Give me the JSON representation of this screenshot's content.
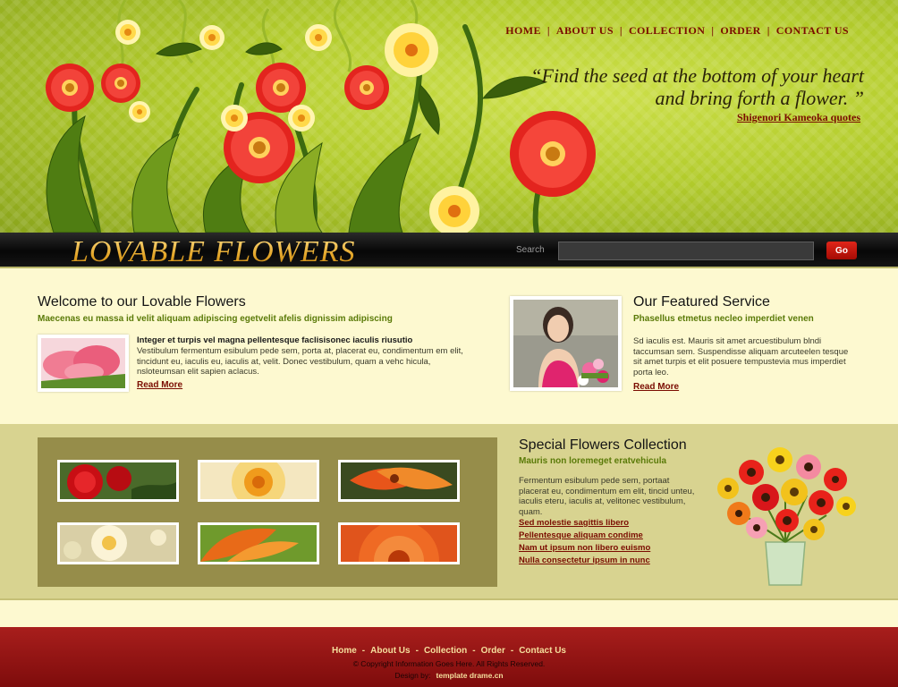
{
  "nav": {
    "home": "HOME",
    "about": "ABOUT US",
    "collection": "COLLECTION",
    "order": "ORDER",
    "contact": "CONTACT US",
    "separator": "|"
  },
  "quote": {
    "text": "“Find the seed at the bottom of your heart and bring forth a flower. ”",
    "author": "Shigenori Kameoka quotes"
  },
  "brand": {
    "logo": "LOVABLE FLOWERS"
  },
  "search": {
    "label": "Search",
    "value": "",
    "button": "Go"
  },
  "welcome": {
    "title": "Welcome to our Lovable Flowers",
    "subtitle": "Maecenas eu massa id velit aliquam adipiscing egetvelit afelis dignissim adipiscing",
    "heading": "Integer et turpis vel magna pellentesque faclisisonec iaculis riusutio",
    "body": "Vestibulum fermentum esibulum pede sem, porta at, placerat eu, condimentum em elit, tincidunt eu, iaculis eu, iaculis at, velit. Donec vestibulum, quam a vehc hicula, nsloteumsan elit sapien aclacus.",
    "read_more": "Read More"
  },
  "featured": {
    "title": "Our Featured Service",
    "subtitle": "Phasellus etmetus necleo imperdiet venen",
    "body": "Sd iaculis est. Mauris sit amet arcuestibulum blndi taccumsan sem. Suspendisse aliquam arcuteelen tesque sit amet turpis et elit posuere tempustevia mus imperdiet porta leo.",
    "read_more": "Read More"
  },
  "special": {
    "title": "Special Flowers Collection",
    "subtitle": "Mauris non loremeget eratvehicula",
    "body": "Fermentum esibulum pede sem, portaat placerat eu, condimentum em elit, tincid unteu, iaculis eteru, iaculis at, velitonec vestibulum, quam.",
    "links": [
      "Sed molestie sagittis libero",
      "Pellentesque aliquam condime",
      "Nam ut ipsum non libero euismo",
      "Nulla consectetur ipsum in nunc"
    ]
  },
  "footer": {
    "nav": [
      "Home",
      "About Us",
      "Collection",
      "Order",
      "Contact Us"
    ],
    "separator": "-",
    "copyright": "© Copyright Information Goes Here. All Rights Reserved.",
    "design_label": "Design by:",
    "design_credit": "template drame.cn"
  },
  "colors": {
    "accent_red": "#7a0c00",
    "header_green": "#b3cc2c",
    "subtitle_green": "#5a7a08",
    "footer_red": "#9b1614",
    "logo_gold": "#e3a426"
  },
  "icons": {
    "header_art": "flower-illustration",
    "gallery_images": [
      "red-rose-photo",
      "yellow-flower-photo",
      "orange-lily-photo",
      "white-blossom-photo",
      "orange-petals-photo",
      "gerbera-photo"
    ]
  }
}
